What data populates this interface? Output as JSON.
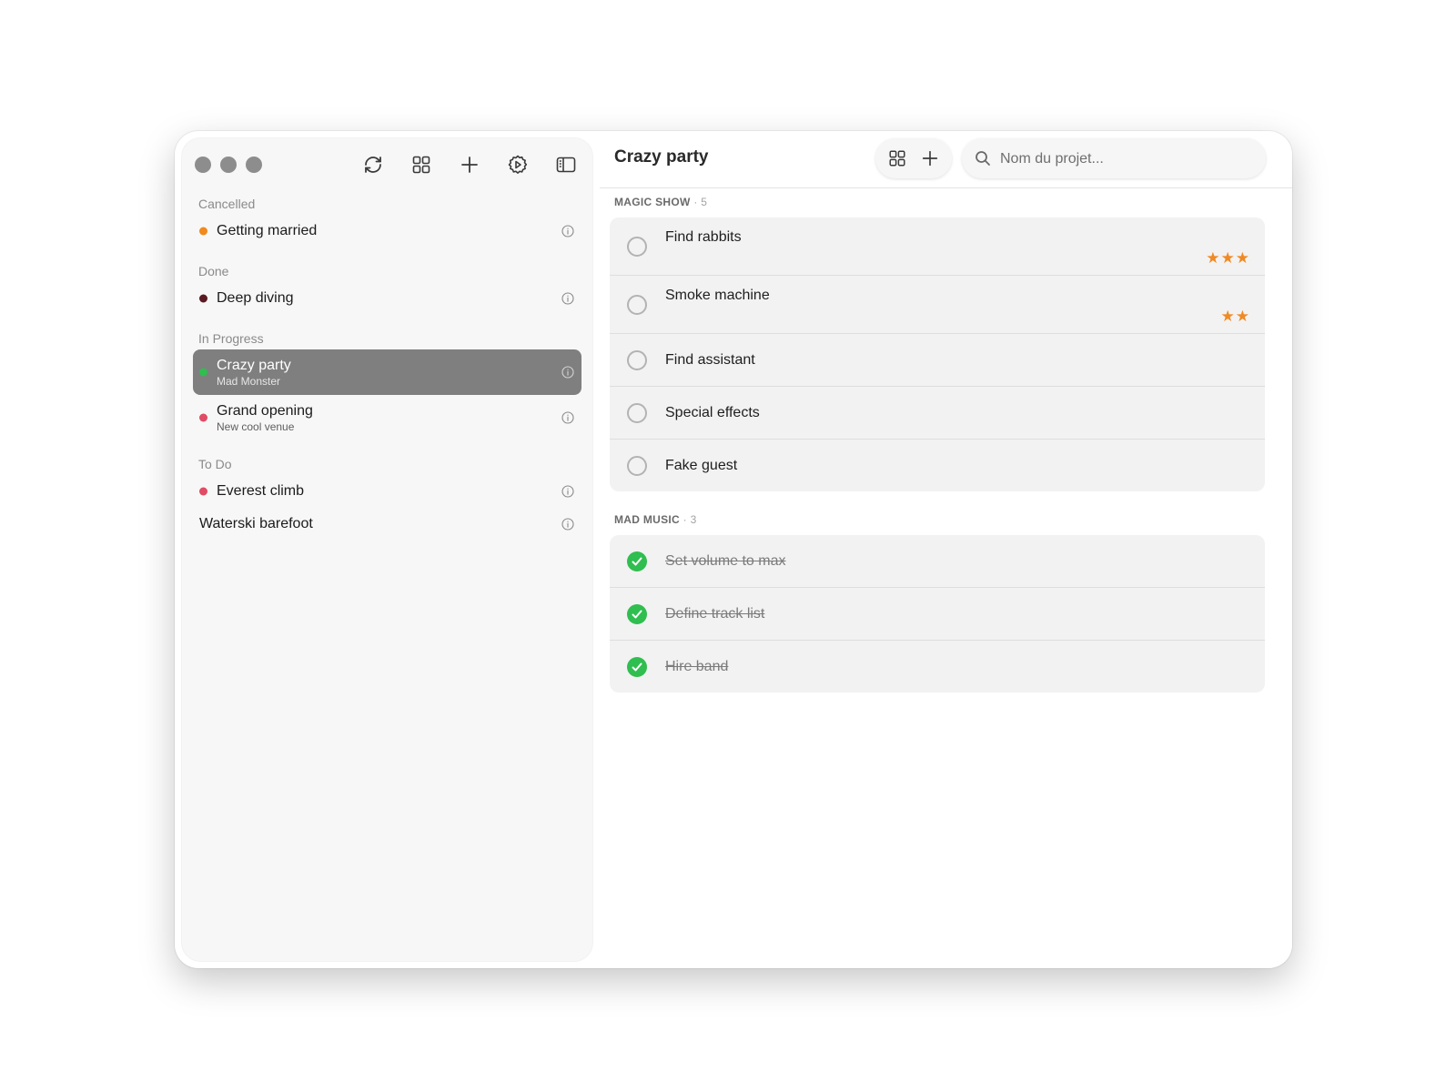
{
  "sidebar": {
    "groups": [
      {
        "title": "Cancelled",
        "items": [
          {
            "name": "Getting married",
            "color": "#f0891e"
          }
        ]
      },
      {
        "title": "Done",
        "items": [
          {
            "name": "Deep diving",
            "color": "#5b1a22"
          }
        ]
      },
      {
        "title": "In Progress",
        "items": [
          {
            "name": "Crazy party",
            "subtitle": "Mad Monster",
            "color": "#2fbe4f",
            "selected": true
          },
          {
            "name": "Grand opening",
            "subtitle": "New cool venue",
            "color": "#e14b63"
          }
        ]
      },
      {
        "title": "To Do",
        "items": [
          {
            "name": "Everest climb",
            "color": "#e14b63"
          },
          {
            "name": "Waterski barefoot"
          }
        ]
      }
    ]
  },
  "toolbar": {
    "icons": [
      "sync-icon",
      "grid-icon",
      "plus-icon",
      "settings-icon",
      "sidebar-toggle-icon"
    ]
  },
  "main": {
    "title": "Crazy party",
    "search": {
      "placeholder": "Nom du projet...",
      "value": ""
    },
    "sections": [
      {
        "title": "MAGIC SHOW",
        "count": "· 5",
        "tasks": [
          {
            "label": "Find rabbits",
            "done": false,
            "stars": "★★★"
          },
          {
            "label": "Smoke machine",
            "done": false,
            "stars": "★★"
          },
          {
            "label": "Find assistant",
            "done": false
          },
          {
            "label": "Special effects",
            "done": false
          },
          {
            "label": "Fake guest",
            "done": false
          }
        ]
      },
      {
        "title": "MAD MUSIC",
        "count": "· 3",
        "tasks": [
          {
            "label": "Set volume to max",
            "done": true
          },
          {
            "label": "Define track list",
            "done": true
          },
          {
            "label": "Hire band",
            "done": true
          }
        ]
      }
    ]
  },
  "colors": {
    "accent_done": "#2fbe4f",
    "star": "#f08a24",
    "selected_bg": "#7f7f7f"
  }
}
